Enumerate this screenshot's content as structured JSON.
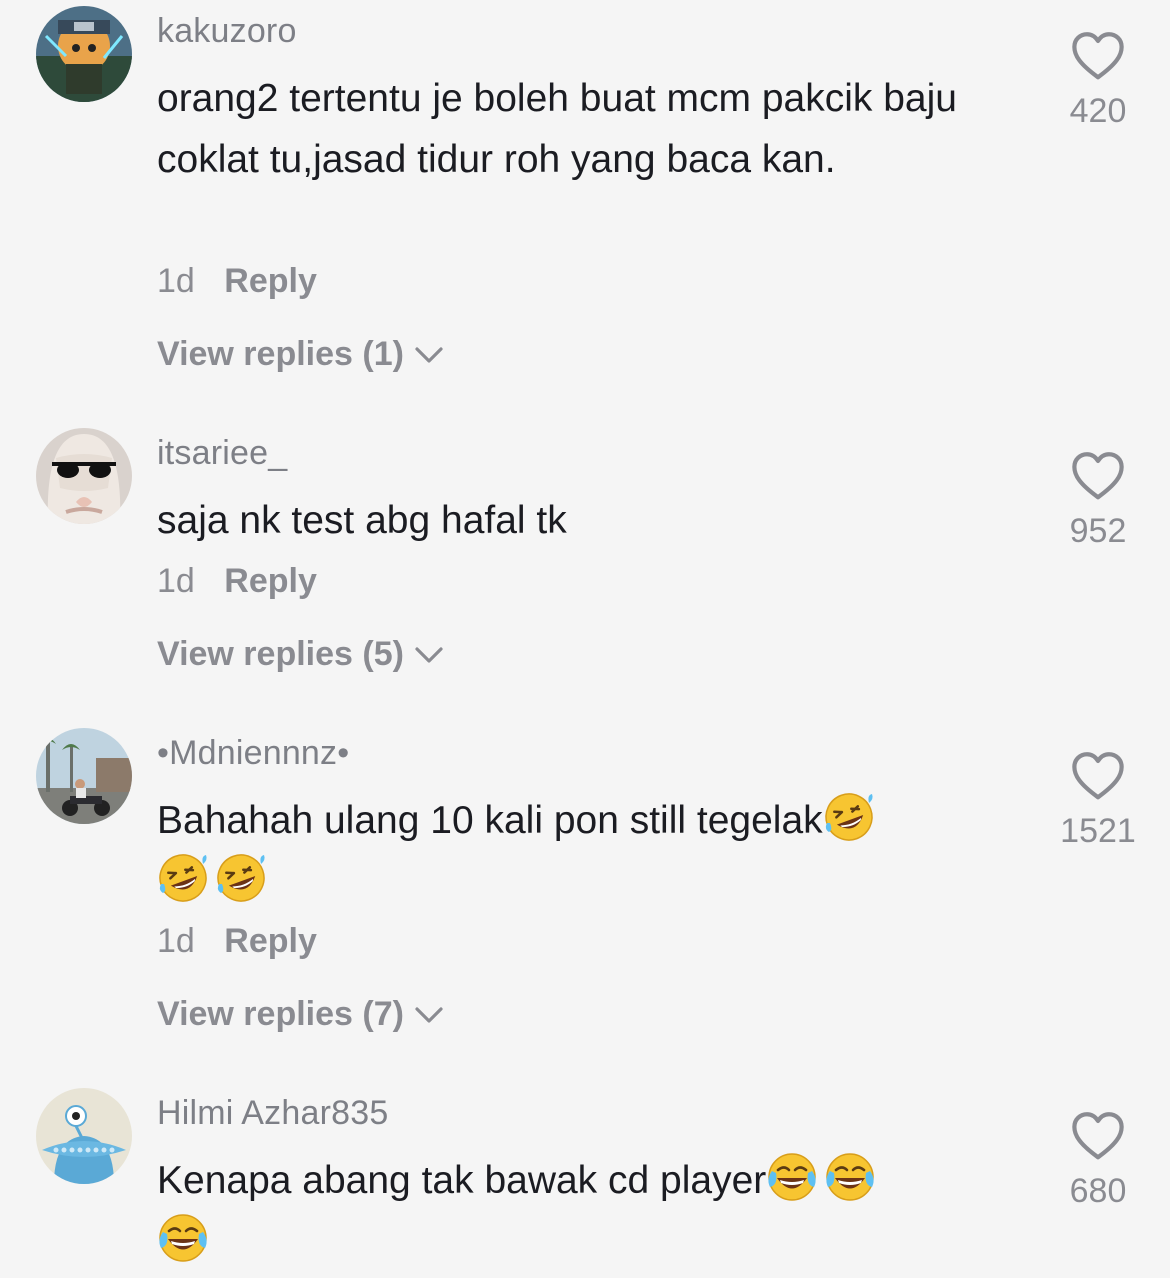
{
  "comments": [
    {
      "username": "kakuzoro",
      "text": "orang2 tertentu je boleh buat mcm pakcik baju coklat tu,jasad tidur roh yang baca kan.",
      "time": "1d",
      "reply_label": "Reply",
      "view_replies": "View replies (1)",
      "likes": "420"
    },
    {
      "username": "itsariee_",
      "text": "saja nk test abg hafal tk",
      "time": "1d",
      "reply_label": "Reply",
      "view_replies": "View replies (5)",
      "likes": "952"
    },
    {
      "username": "•Mdniennnz•",
      "text": "Bahahah ulang 10 kali pon still tegelak",
      "emojis": [
        "rolling-laughing",
        "rolling-laughing",
        "rolling-laughing"
      ],
      "time": "1d",
      "reply_label": "Reply",
      "view_replies": "View replies (7)",
      "likes": "1521"
    },
    {
      "username": "Hilmi Azhar835",
      "text": "Kenapa abang tak bawak cd player",
      "emojis": [
        "tears-of-joy",
        "tears-of-joy",
        "tears-of-joy"
      ],
      "likes": "680"
    }
  ],
  "icons": {
    "like": "heart-outline-icon",
    "expand": "chevron-down-icon"
  },
  "colors": {
    "background": "#f5f5f5",
    "username": "#7d7f86",
    "meta": "#8a8b91",
    "text": "#1b1c22",
    "emoji": "#f7c531"
  }
}
